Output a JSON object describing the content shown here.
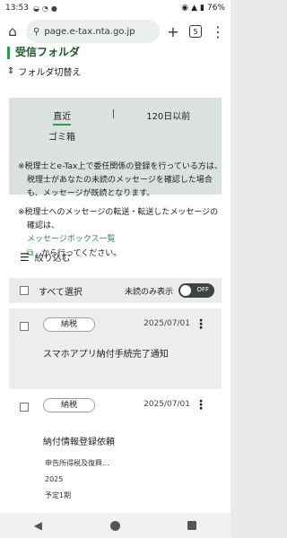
{
  "status_bar": {
    "time": "13:53",
    "battery": "76%"
  },
  "browser": {
    "url": "page.e-tax.nta.go.jp",
    "tab_count": "5"
  },
  "folder": {
    "title": "受信フォルダ",
    "switch_label": "フォルダ切替え"
  },
  "tabs": {
    "recent": "直近",
    "older": "120日以前",
    "trash": "ゴミ箱"
  },
  "notes": {
    "note1": "※税理士とe-Tax上で委任関係の登録を行っている方は、税理士があなたの未読のメッセージを確認した場合も、メッセージが既読となります。",
    "note2": "※税理士へのメッセージの転送・転送したメッセージの確認は、",
    "link_text": "メッセージボックス一覧",
    "note2_suffix": "から行ってください。"
  },
  "filter": {
    "label": "絞り込む"
  },
  "select_bar": {
    "select_all": "すべて選択",
    "unread_only": "未読のみ表示",
    "toggle_state": "OFF"
  },
  "messages": [
    {
      "badge": "納税",
      "date": "2025/07/01",
      "title": "スマホアプリ納付手続完了通知",
      "subitems": []
    },
    {
      "badge": "納税",
      "date": "2025/07/01",
      "title": "納付情報登録依頼",
      "subitems": [
        "申告所得税及復興…",
        "2025",
        "予定1期"
      ]
    }
  ]
}
